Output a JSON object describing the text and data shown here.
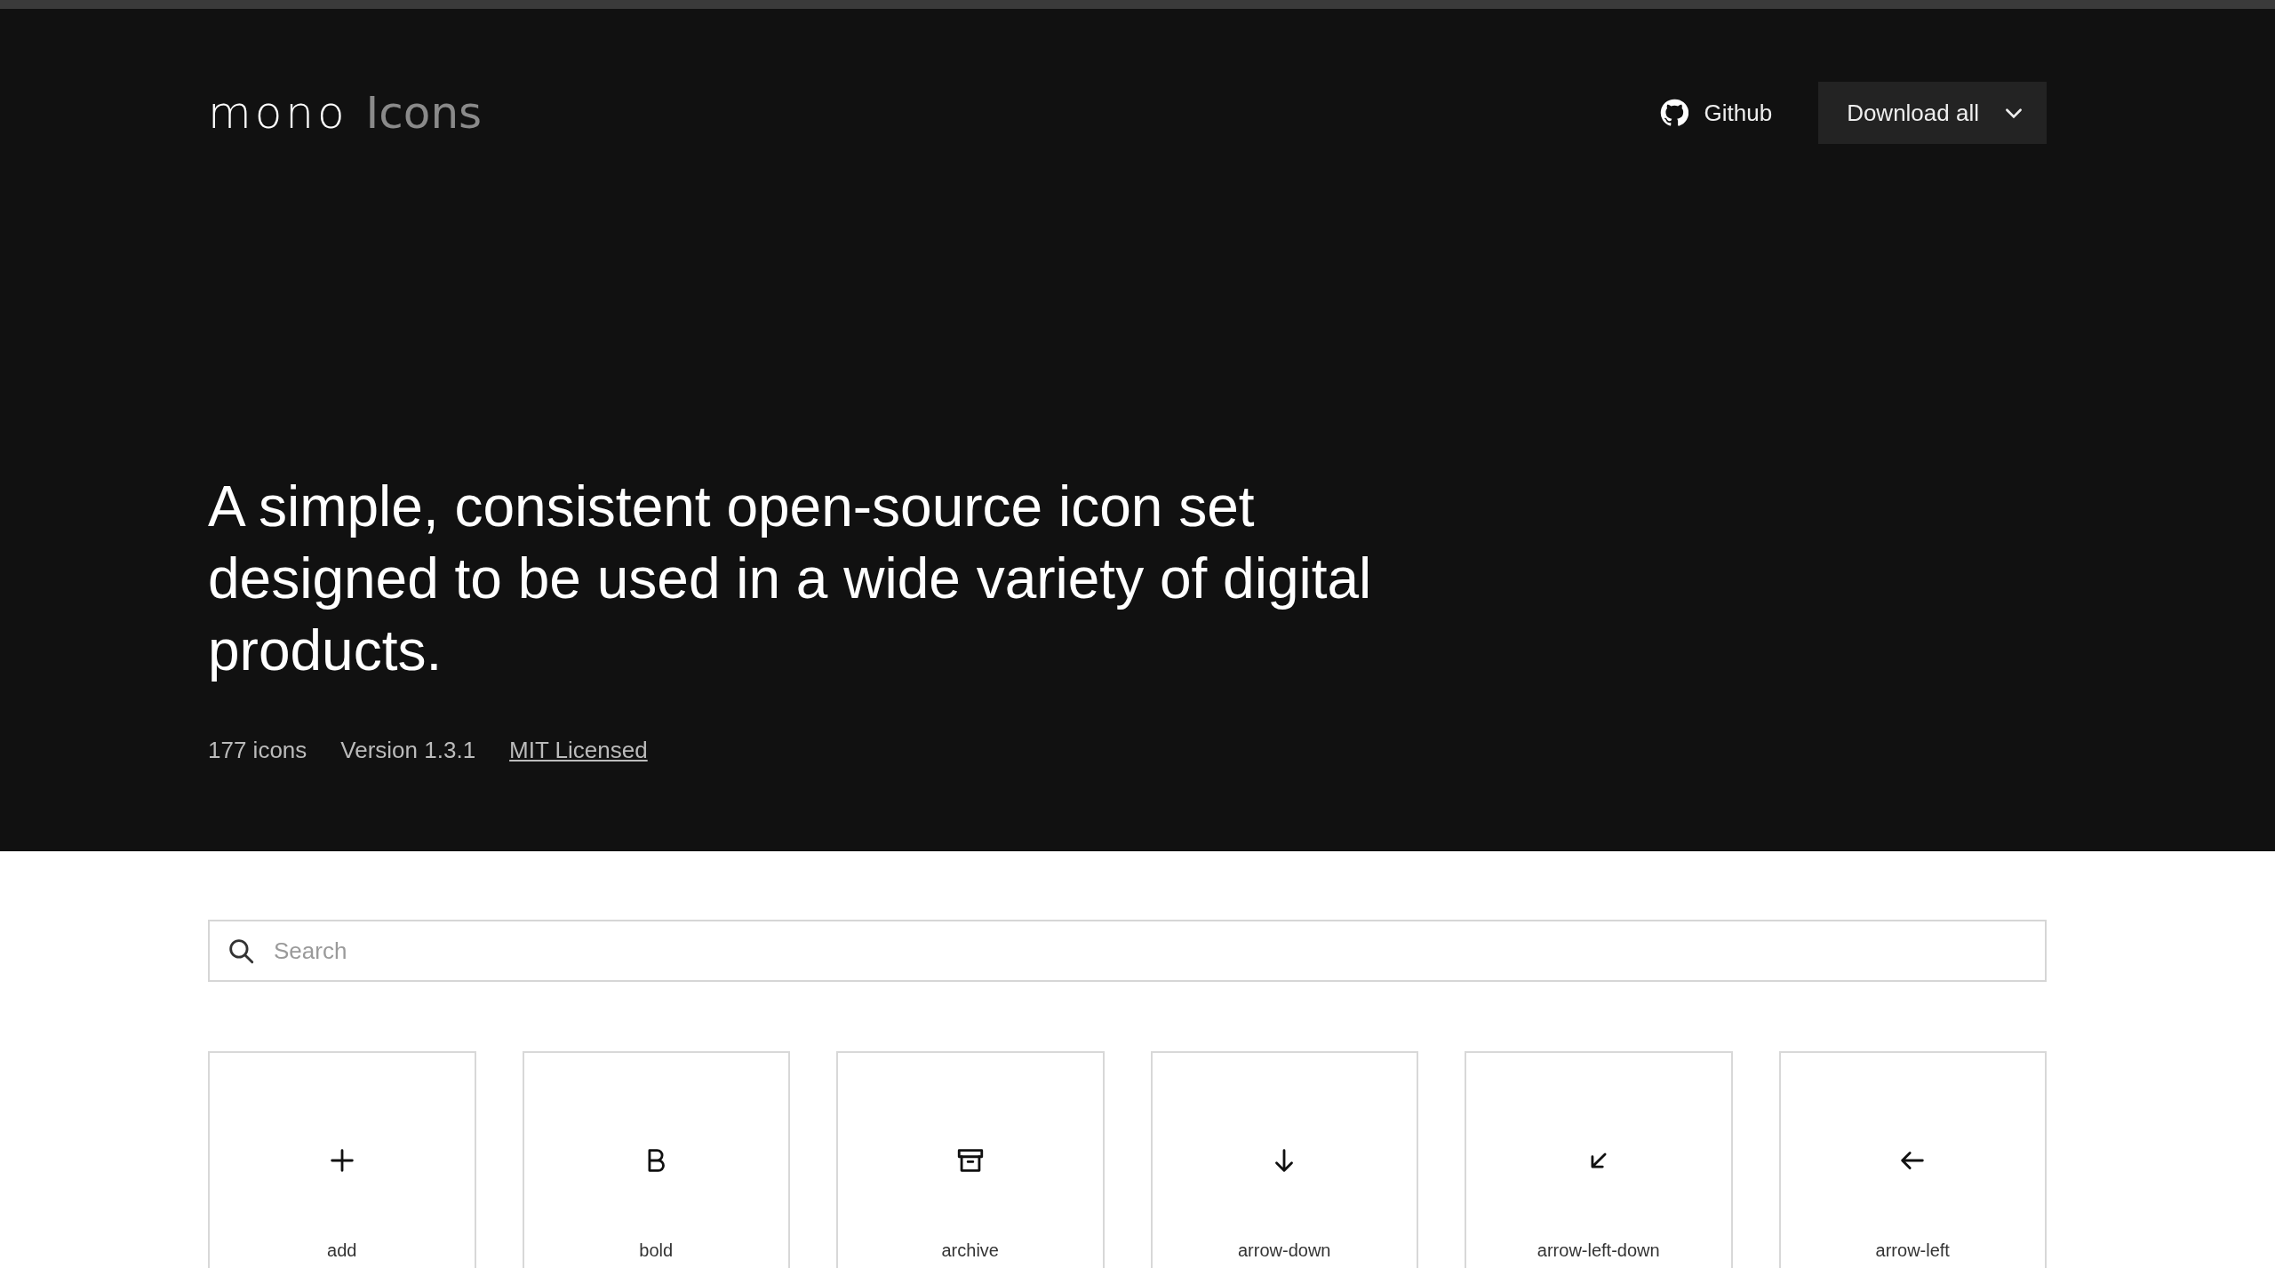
{
  "header": {
    "logo": {
      "wordmark": "mono",
      "suffix": "Icons"
    },
    "github_link": "Github",
    "download_button": "Download all"
  },
  "hero": {
    "headline": "A simple, consistent open-source icon set designed to be used in a wide variety of digital products.",
    "meta": [
      {
        "kind": "text",
        "label": "177 icons"
      },
      {
        "kind": "text",
        "label": "Version 1.3.1"
      },
      {
        "kind": "link",
        "label": "MIT Licensed"
      }
    ]
  },
  "search": {
    "placeholder": "Search"
  },
  "icons": [
    {
      "kind": "add",
      "name": "add"
    },
    {
      "kind": "bold",
      "name": "bold"
    },
    {
      "kind": "archive",
      "name": "archive"
    },
    {
      "kind": "arrow-down",
      "name": "arrow-down"
    },
    {
      "kind": "arrow-left-down",
      "name": "arrow-left-down"
    },
    {
      "kind": "arrow-left",
      "name": "arrow-left"
    }
  ]
}
